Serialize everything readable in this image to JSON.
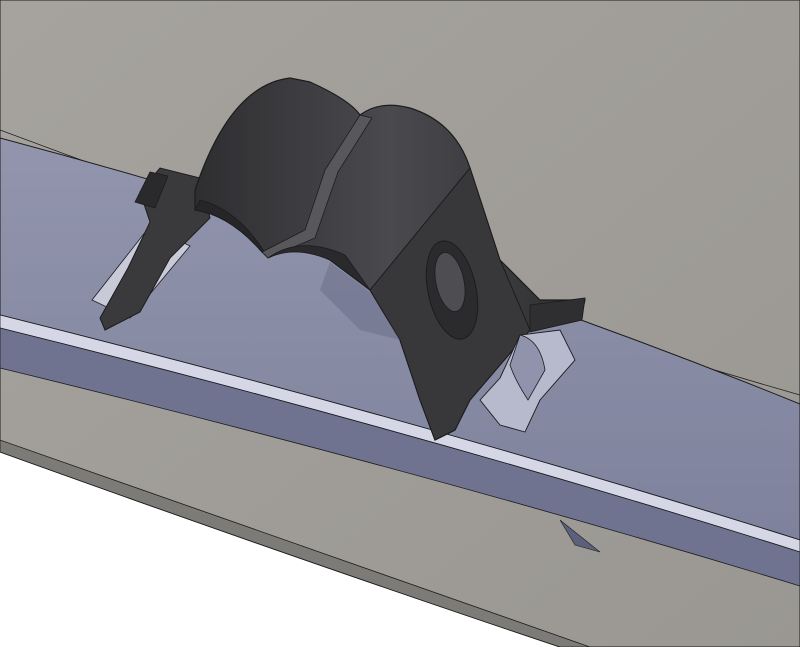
{
  "scene": {
    "kind": "cad-render",
    "description_visible_text": "",
    "colors": {
      "background": "#ffffff",
      "panel": "#a3a09b",
      "panel_dark": "#7d7b77",
      "rail_top": "#8e91aa",
      "rail_front": "#6f738f",
      "rail_lip": "#d5d7e6",
      "clip": "#3d3d40",
      "clip_dark": "#262628",
      "clip_light": "#58585c",
      "edge": "#1c1c1e"
    }
  }
}
